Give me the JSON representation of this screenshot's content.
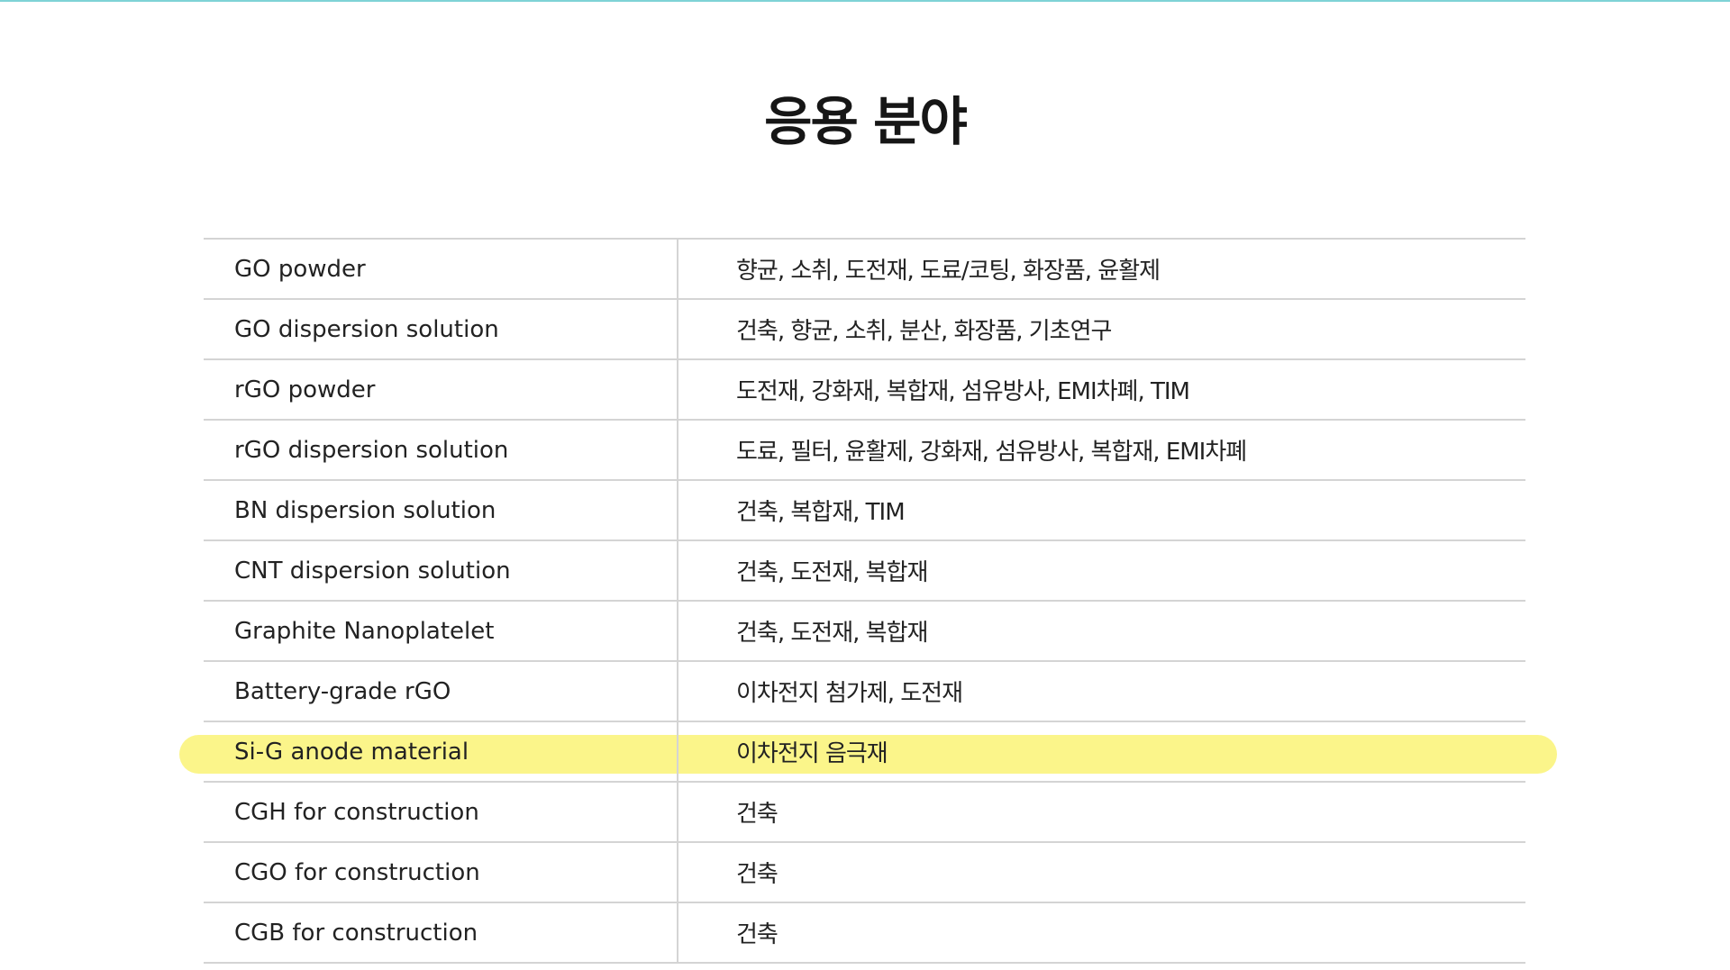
{
  "title": "응용 분야",
  "rows": [
    {
      "product": "GO powder",
      "applications": "향균, 소취, 도전재, 도료/코팅, 화장품, 윤활제",
      "highlighted": false
    },
    {
      "product": "GO dispersion solution",
      "applications": "건축, 향균, 소취, 분산, 화장품, 기초연구",
      "highlighted": false
    },
    {
      "product": "rGO powder",
      "applications": "도전재, 강화재, 복합재, 섬유방사, EMI차폐, TIM",
      "highlighted": false
    },
    {
      "product": "rGO dispersion solution",
      "applications": "도료, 필터, 윤활제, 강화재, 섬유방사, 복합재, EMI차폐",
      "highlighted": false
    },
    {
      "product": "BN dispersion solution",
      "applications": "건축, 복합재, TIM",
      "highlighted": false
    },
    {
      "product": "CNT dispersion solution",
      "applications": "건축, 도전재, 복합재",
      "highlighted": false
    },
    {
      "product": "Graphite Nanoplatelet",
      "applications": "건축, 도전재, 복합재",
      "highlighted": false
    },
    {
      "product": "Battery-grade rGO",
      "applications": "이차전지 첨가제, 도전재",
      "highlighted": false
    },
    {
      "product": "Si-G anode material",
      "applications": "이차전지 음극재",
      "highlighted": true
    },
    {
      "product": "CGH for construction",
      "applications": "건축",
      "highlighted": false
    },
    {
      "product": "CGO for construction",
      "applications": "건축",
      "highlighted": false
    },
    {
      "product": "CGB for construction",
      "applications": "건축",
      "highlighted": false
    }
  ],
  "colors": {
    "highlight": "#fbf58a",
    "divider": "#d4d4d4",
    "top_accent": "#7fd3d6"
  }
}
